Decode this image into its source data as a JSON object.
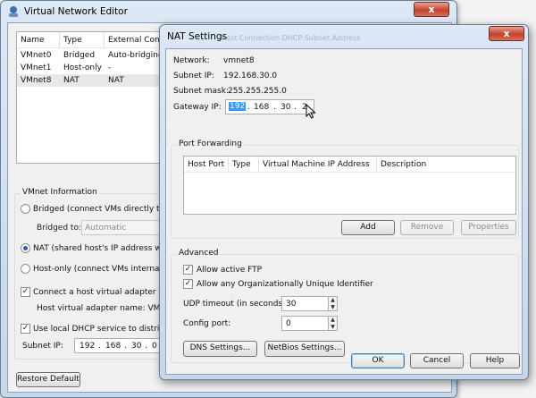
{
  "main_window": {
    "title": "Virtual Network Editor",
    "close_glyph": "x",
    "table": {
      "columns": [
        "Name",
        "Type",
        "External Conne"
      ],
      "rows": [
        [
          "VMnet0",
          "Bridged",
          "Auto-bridging"
        ],
        [
          "VMnet1",
          "Host-only",
          "-"
        ],
        [
          "VMnet8",
          "NAT",
          "NAT"
        ]
      ]
    },
    "vmnet_info": {
      "legend": "VMnet Information",
      "bridged_label": "Bridged (connect VMs directly to the",
      "bridged_to_label": "Bridged to:",
      "bridged_to_value": "Automatic",
      "nat_label": "NAT (shared host's IP address with",
      "host_only_label": "Host-only (connect VMs internally in",
      "connect_adapter_label": "Connect a host virtual adapter to th",
      "adapter_name_label": "Host virtual adapter name: VMware",
      "dhcp_label": "Use local DHCP service to distribute",
      "selected_mode": "nat",
      "connect_adapter_checked": true,
      "dhcp_checked": true
    },
    "subnet_ip_label": "Subnet IP:",
    "subnet_ip_octets": [
      "192",
      "168",
      "30",
      "0"
    ],
    "restore_default_label": "Restore Default"
  },
  "nat_dialog": {
    "title": "NAT Settings",
    "faded_background_text": "Host Connection   DHCP   Subnet Address",
    "close_glyph": "x",
    "network_label": "Network:",
    "network_value": "vmnet8",
    "subnet_ip_label": "Subnet IP:",
    "subnet_ip_value": "192.168.30.0",
    "subnet_mask_label": "Subnet mask:",
    "subnet_mask_value": "255.255.255.0",
    "gateway_ip_label": "Gateway IP:",
    "gateway_octets": [
      "192",
      "168",
      "30",
      "2"
    ],
    "port_forwarding": {
      "legend": "Port Forwarding",
      "columns": [
        "Host Port",
        "Type",
        "Virtual Machine IP Address",
        "Description"
      ],
      "rows": [],
      "add_label": "Add",
      "remove_label": "Remove",
      "properties_label": "Properties"
    },
    "advanced": {
      "legend": "Advanced",
      "allow_active_ftp_label": "Allow active FTP",
      "allow_active_ftp_checked": true,
      "allow_oui_label": "Allow any Organizationally Unique Identifier",
      "allow_oui_checked": true,
      "udp_timeout_label": "UDP timeout (in seconds):",
      "udp_timeout_value": "30",
      "config_port_label": "Config port:",
      "config_port_value": "0",
      "dns_settings_label": "DNS Settings...",
      "netbios_settings_label": "NetBios Settings..."
    },
    "ok_label": "OK",
    "cancel_label": "Cancel",
    "help_label": "Help"
  },
  "colors": {
    "selection": "#3399ff",
    "close_button": "#c5422c",
    "title_bar": "#c5d7ea"
  }
}
